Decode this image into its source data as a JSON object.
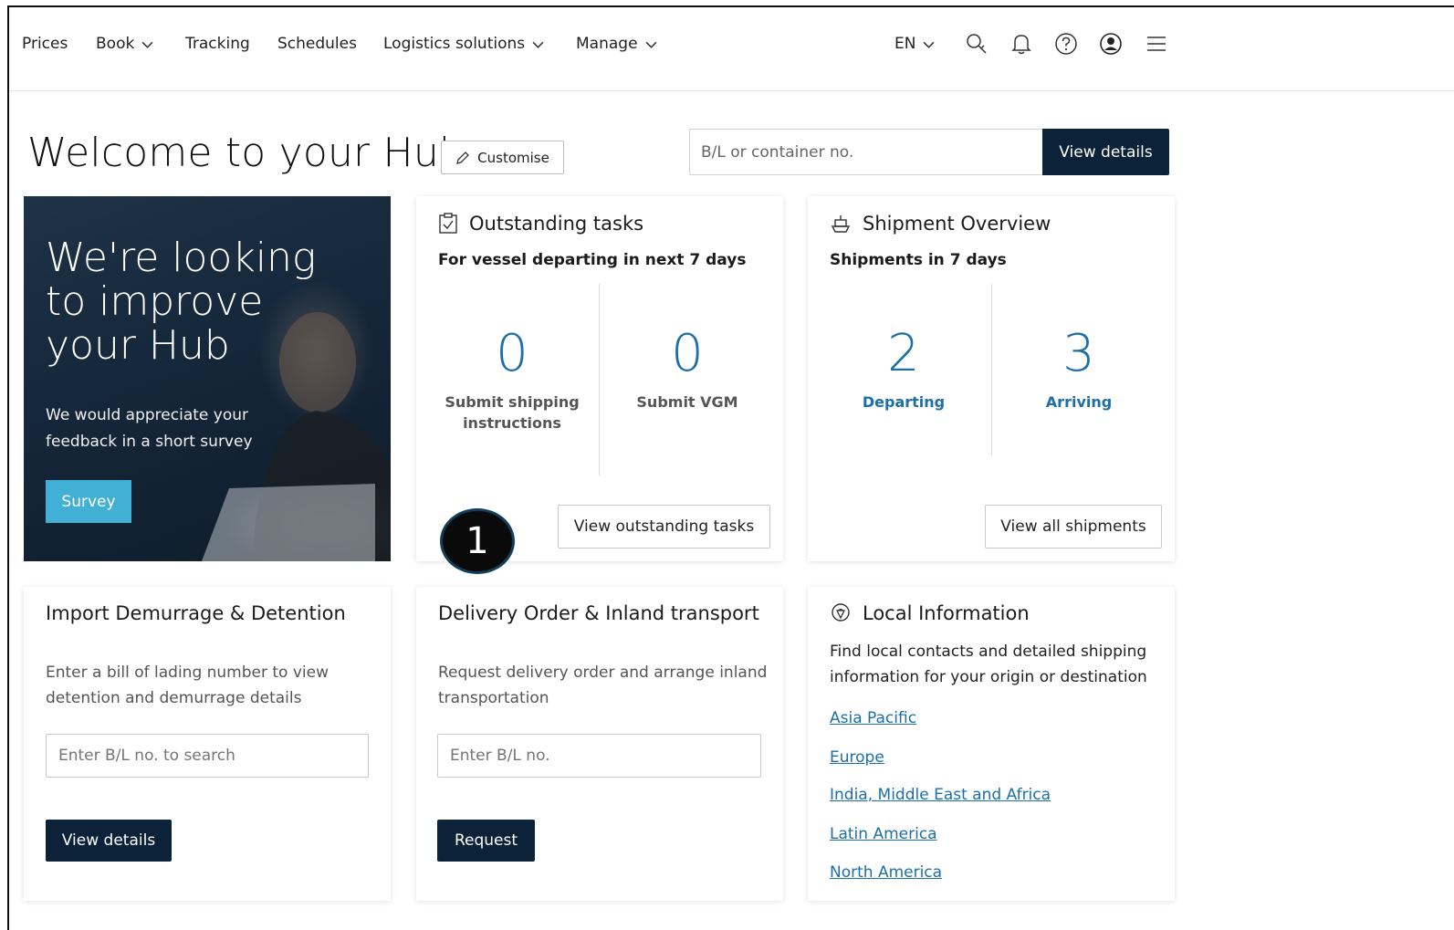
{
  "nav": {
    "items": [
      {
        "label": "Prices",
        "dropdown": false
      },
      {
        "label": "Book",
        "dropdown": true
      },
      {
        "label": "Tracking",
        "dropdown": false
      },
      {
        "label": "Schedules",
        "dropdown": false
      },
      {
        "label": "Logistics solutions",
        "dropdown": true
      },
      {
        "label": "Manage",
        "dropdown": true
      }
    ],
    "language": "EN",
    "icons": [
      "search-icon",
      "bell-icon",
      "help-icon",
      "user-icon",
      "menu-icon"
    ]
  },
  "header": {
    "title": "Welcome to your Hub",
    "customise_label": "Customise",
    "search_placeholder": "B/L or container no.",
    "view_details_label": "View details"
  },
  "survey": {
    "heading": [
      "We're looking",
      "to improve",
      "your Hub"
    ],
    "text": [
      "We would appreciate your",
      "feedback in a short survey"
    ],
    "button_label": "Survey"
  },
  "tasks": {
    "title": "Outstanding tasks",
    "subtitle": "For vessel departing in next 7 days",
    "stats": [
      {
        "value": "0",
        "label_lines": [
          "Submit shipping",
          "instructions"
        ]
      },
      {
        "value": "0",
        "label_lines": [
          "Submit VGM"
        ]
      }
    ],
    "button_label": "View outstanding tasks"
  },
  "shipments": {
    "title": "Shipment Overview",
    "subtitle": "Shipments in 7 days",
    "stats": [
      {
        "value": "2",
        "label": "Departing"
      },
      {
        "value": "3",
        "label": "Arriving"
      }
    ],
    "button_label": "View all shipments"
  },
  "demurrage": {
    "title": "Import Demurrage & Detention",
    "desc_lines": [
      "Enter a bill of lading number to view",
      "detention and demurrage details"
    ],
    "input_placeholder": "Enter B/L no. to search",
    "button_label": "View details"
  },
  "delivery": {
    "title": "Delivery Order & Inland transport",
    "desc_lines": [
      "Request delivery order and arrange inland",
      "transportation"
    ],
    "input_placeholder": "Enter B/L no.",
    "button_label": "Request"
  },
  "local": {
    "title": "Local Information",
    "desc_lines": [
      "Find local contacts and detailed shipping",
      "information for your origin or destination"
    ],
    "links": [
      "Asia Pacific",
      "Europe",
      "India, Middle East and Africa",
      "Latin America",
      "North America"
    ]
  },
  "badge": {
    "number": "1"
  },
  "colors": {
    "navy": "#0b2239",
    "accent_blue": "#1d6fa5",
    "survey_button": "#42b0d5"
  }
}
